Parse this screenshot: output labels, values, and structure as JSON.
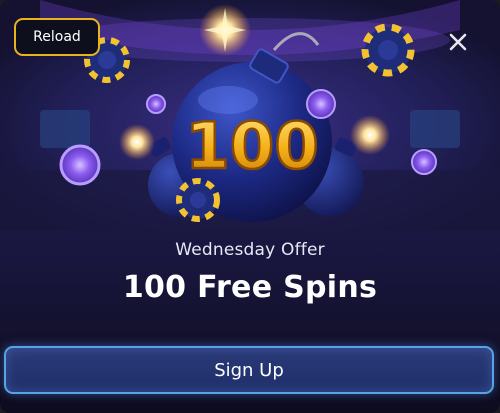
{
  "header": {
    "reload_label": "Reload",
    "close_icon": "close-icon"
  },
  "hero": {
    "bomb_number": "100",
    "icons": [
      "bomb-icon",
      "casino-chip-icon",
      "sparkle-icon"
    ]
  },
  "offer": {
    "subtitle": "Wednesday Offer",
    "title": "100 Free Spins"
  },
  "cta": {
    "label": "Sign Up"
  },
  "colors": {
    "gold": "#f2b41c",
    "button_border": "#5aa2e8",
    "reload_border": "#e8b31f",
    "chip_navy": "#1f2c7a"
  }
}
